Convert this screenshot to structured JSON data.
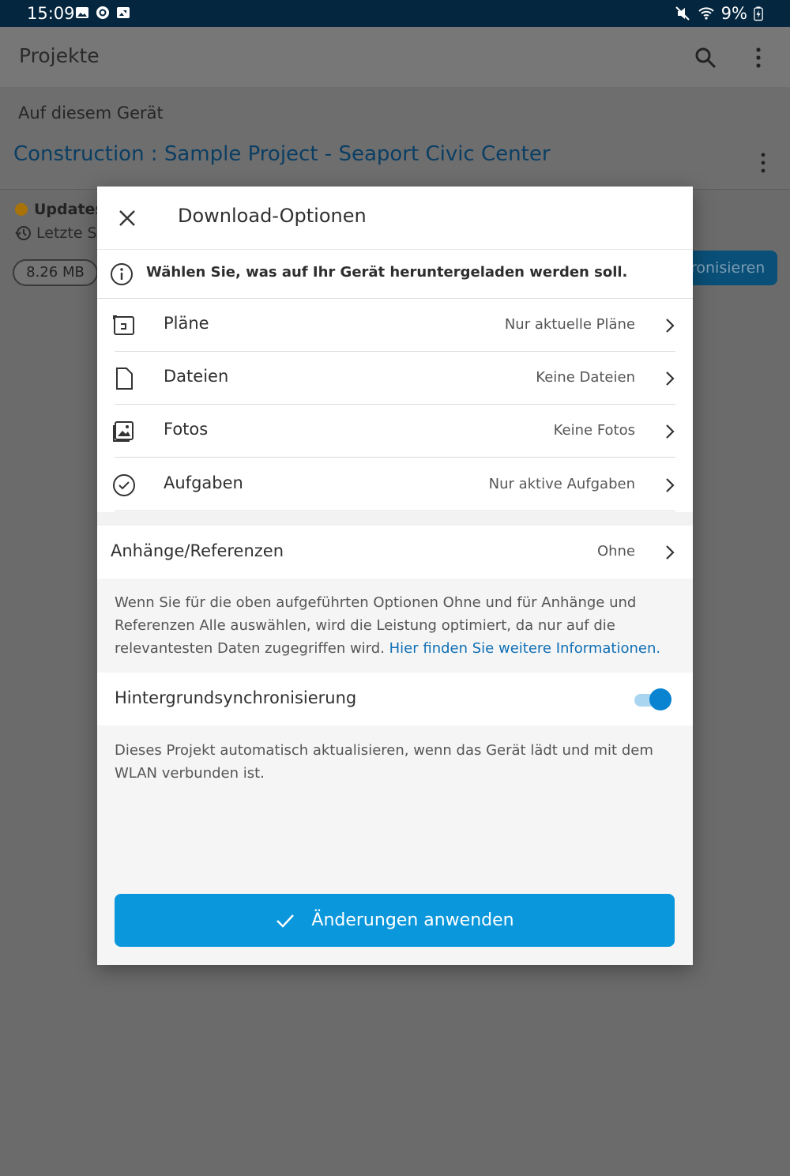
{
  "status_bar": {
    "time": "15:09",
    "battery": "9%",
    "left_icons": [
      "gallery-icon",
      "sync-icon",
      "screenshot-icon"
    ],
    "right_icons": [
      "mute-icon",
      "wifi-icon",
      "battery-charging-icon"
    ]
  },
  "app_bar": {
    "title": "Projekte",
    "icons": [
      "search-icon",
      "more-vertical-icon"
    ]
  },
  "background": {
    "section_label": "Auf diesem Gerät",
    "project_title": "Construction : Sample Project - Seaport Civic Center",
    "updates_label": "Updates",
    "last_sync_label": "Letzte Sy",
    "size": "8.26 MB",
    "sync_button": "ronisieren"
  },
  "dialog": {
    "title": "Download-Optionen",
    "info_text": "Wählen Sie, was auf Ihr Gerät heruntergeladen werden soll.",
    "rows": [
      {
        "label": "Pläne",
        "value": "Nur aktuelle Pläne",
        "icon": "sheets-icon"
      },
      {
        "label": "Dateien",
        "value": "Keine Dateien",
        "icon": "file-icon"
      },
      {
        "label": "Fotos",
        "value": "Keine Fotos",
        "icon": "photos-icon"
      },
      {
        "label": "Aufgaben",
        "value": "Nur aktive Aufgaben",
        "icon": "task-check-icon"
      }
    ],
    "attachments": {
      "label": "Anhänge/Referenzen",
      "value": "Ohne"
    },
    "note_text": "Wenn Sie für die oben aufgeführten Optionen Ohne und für Anhänge und Referenzen Alle auswählen, wird die Leistung optimiert, da nur auf die relevantesten Daten zugegriffen wird. ",
    "note_link": "Hier finden Sie weitere Informationen.",
    "background_sync": {
      "label": "Hintergrundsynchronisierung",
      "enabled": true
    },
    "sync_note": "Dieses Projekt automatisch aktualisieren, wenn das Gerät lädt und mit dem WLAN verbunden ist.",
    "apply_button": "Änderungen anwenden"
  },
  "colors": {
    "accent": "#0a97dc",
    "link": "#0f6fb5",
    "status_bar": "#04263f"
  }
}
